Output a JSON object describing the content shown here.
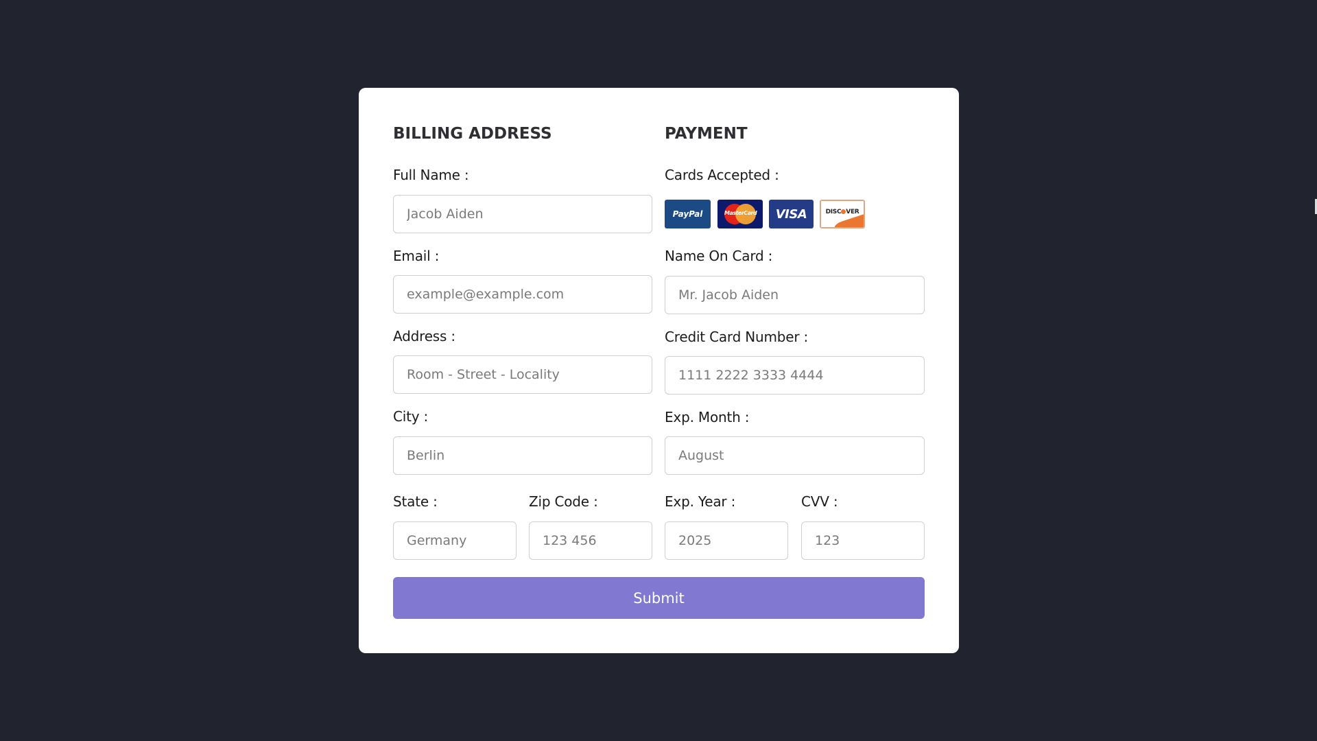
{
  "billing": {
    "title": "BILLING ADDRESS",
    "full_name": {
      "label": "Full Name :",
      "placeholder": "Jacob Aiden",
      "value": ""
    },
    "email": {
      "label": "Email :",
      "placeholder": "example@example.com",
      "value": ""
    },
    "address": {
      "label": "Address :",
      "placeholder": "Room - Street - Locality",
      "value": ""
    },
    "city": {
      "label": "City :",
      "placeholder": "Berlin",
      "value": ""
    },
    "state": {
      "label": "State :",
      "placeholder": "Germany",
      "value": ""
    },
    "zip": {
      "label": "Zip Code :",
      "placeholder": "123 456",
      "value": ""
    }
  },
  "payment": {
    "title": "PAYMENT",
    "cards_accepted_label": "Cards Accepted :",
    "cards": [
      {
        "name": "PayPal",
        "icon": "paypal-icon",
        "color": "#1c4a84"
      },
      {
        "name": "MasterCard",
        "icon": "mastercard-icon",
        "color": "#0d1a6b"
      },
      {
        "name": "VISA",
        "icon": "visa-icon",
        "color": "#243b87"
      },
      {
        "name": "DISCOVER",
        "icon": "discover-icon",
        "color": "#ea7630"
      }
    ],
    "name_on_card": {
      "label": "Name On Card :",
      "placeholder": "Mr. Jacob Aiden",
      "value": ""
    },
    "card_number": {
      "label": "Credit Card Number :",
      "placeholder": "1111 2222 3333 4444",
      "value": ""
    },
    "exp_month": {
      "label": "Exp. Month :",
      "placeholder": "August",
      "value": ""
    },
    "exp_year": {
      "label": "Exp. Year :",
      "placeholder": "2025",
      "value": ""
    },
    "cvv": {
      "label": "CVV :",
      "placeholder": "123",
      "value": ""
    }
  },
  "submit_label": "Submit",
  "colors": {
    "background": "#21242e",
    "card": "#ffffff",
    "accent": "#8178d1",
    "input_border": "#cfcfcf"
  }
}
